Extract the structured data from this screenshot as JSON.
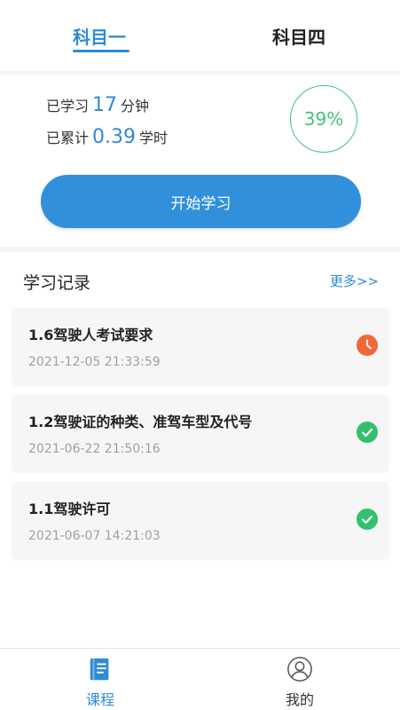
{
  "tabs": [
    {
      "label": "科目一",
      "active": true
    },
    {
      "label": "科目四",
      "active": false
    }
  ],
  "stats": {
    "studied_prefix": "已学习",
    "studied_value": "17",
    "studied_unit": "分钟",
    "total_prefix": "已累计",
    "total_value": "0.39",
    "total_unit": "学时",
    "progress_label": "39%",
    "progress_color": "#3ec47a"
  },
  "start_button": {
    "label": "开始学习",
    "color": "#3190dc"
  },
  "records": {
    "title": "学习记录",
    "more_label": "更多>>",
    "items": [
      {
        "title": "1.6驾驶人考试要求",
        "time": "2021-12-05 21:33:59",
        "status": "clock-icon",
        "status_color": "#f2673a"
      },
      {
        "title": "1.2驾驶证的种类、准驾车型及代号",
        "time": "2021-06-22 21:50:16",
        "status": "check-icon",
        "status_color": "#32c06f"
      },
      {
        "title": "1.1驾驶许可",
        "time": "2021-06-07 14:21:03",
        "status": "check-icon",
        "status_color": "#32c06f"
      }
    ]
  },
  "bottom_nav": [
    {
      "label": "课程",
      "icon": "book-icon",
      "active": true
    },
    {
      "label": "我的",
      "icon": "user-icon",
      "active": false
    }
  ],
  "accent_color": "#2f8ad7"
}
